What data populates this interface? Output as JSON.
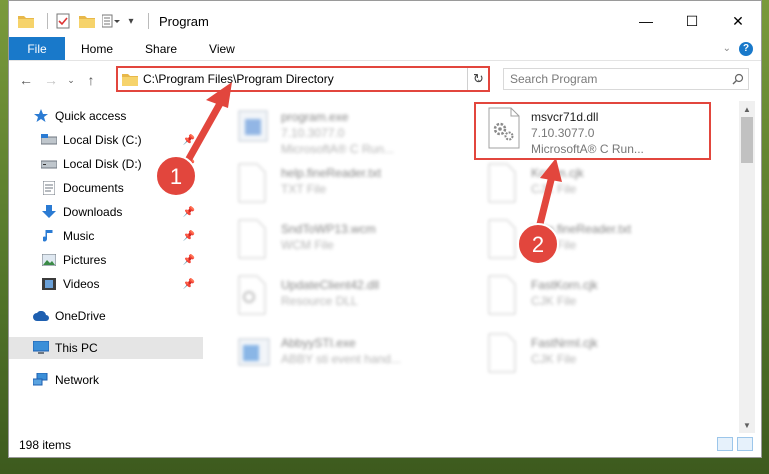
{
  "window": {
    "title": "Program",
    "controls": {
      "minimize": "—",
      "maximize": "☐",
      "close": "✕"
    }
  },
  "ribbon": {
    "file_tab": "File",
    "tabs": [
      "Home",
      "Share",
      "View"
    ]
  },
  "address": {
    "path": "C:\\Program Files\\Program Directory"
  },
  "search": {
    "placeholder": "Search Program"
  },
  "sidebar": {
    "items": [
      {
        "label": "Quick access",
        "icon": "star-icon"
      },
      {
        "label": "Local Disk (C:)",
        "icon": "drive-icon"
      },
      {
        "label": "Local Disk (D:)",
        "icon": "drive-icon"
      },
      {
        "label": "Documents",
        "icon": "documents-icon"
      },
      {
        "label": "Downloads",
        "icon": "download-icon"
      },
      {
        "label": "Music",
        "icon": "music-icon"
      },
      {
        "label": "Pictures",
        "icon": "pictures-icon"
      },
      {
        "label": "Videos",
        "icon": "videos-icon"
      },
      {
        "label": "OneDrive",
        "icon": "cloud-icon"
      },
      {
        "label": "This PC",
        "icon": "computer-icon"
      },
      {
        "label": "Network",
        "icon": "network-icon"
      }
    ]
  },
  "files": [
    {
      "name": "program.exe",
      "line2": "7.10.3077.0",
      "line3": "MicrosoftA® C Run...",
      "blurred": true
    },
    {
      "name": "msvcr71d.dll",
      "line2": "7.10.3077.0",
      "line3": "MicrosoftA® C Run...",
      "blurred": false
    },
    {
      "name": "help.fineReader.txt",
      "line2": "TXT File",
      "line3": "",
      "blurred": true
    },
    {
      "name": "Kcrom.cjk",
      "line2": "CJK File",
      "line3": "",
      "blurred": true
    },
    {
      "name": "SndToWP13.wcm",
      "line2": "WCM File",
      "line3": "",
      "blurred": true
    },
    {
      "name": "help.fineReader.txt",
      "line2": "TXT File",
      "line3": "",
      "blurred": true
    },
    {
      "name": "UpdateClient42.dll",
      "line2": "Resource DLL",
      "line3": "",
      "blurred": true
    },
    {
      "name": "FastKorn.cjk",
      "line2": "CJK File",
      "line3": "",
      "blurred": true
    },
    {
      "name": "AbbyySTI.exe",
      "line2": "ABBY sti event hand...",
      "line3": "",
      "blurred": true
    },
    {
      "name": "FastNrml.cjk",
      "line2": "CJK File",
      "line3": "",
      "blurred": true
    }
  ],
  "status": {
    "item_count": "198 items"
  },
  "annotations": {
    "badge1": "1",
    "badge2": "2",
    "color": "#e2463d"
  }
}
